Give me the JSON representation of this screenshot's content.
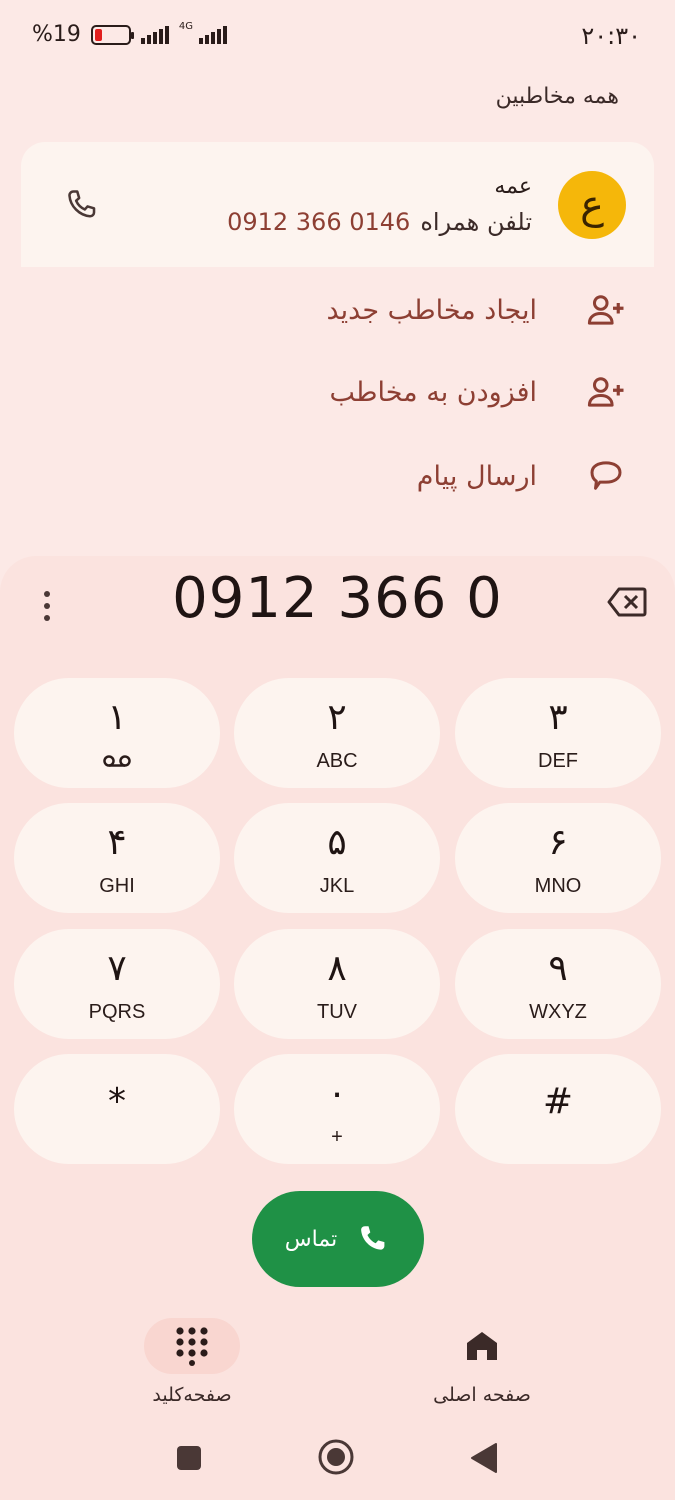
{
  "status_bar": {
    "time": "۲۰:۳۰",
    "battery": "%19",
    "battery_level": 0.19,
    "network": "4G"
  },
  "header": {
    "all_contacts": "همه مخاطبین"
  },
  "contact": {
    "avatar_letter": "ع",
    "name": "عمه",
    "phone_label": "تلفن همراه",
    "phone": "0912 366 0146"
  },
  "actions": [
    {
      "label": "ایجاد مخاطب جدید",
      "icon": "person-add-icon"
    },
    {
      "label": "افزودن به مخاطب",
      "icon": "person-add-icon"
    },
    {
      "label": "ارسال پیام",
      "icon": "message-icon"
    }
  ],
  "dialer": {
    "number": "0912 366 0",
    "keys": [
      {
        "digit": "۱",
        "letters": ""
      },
      {
        "digit": "۲",
        "letters": "ABC"
      },
      {
        "digit": "۳",
        "letters": "DEF"
      },
      {
        "digit": "۴",
        "letters": "GHI"
      },
      {
        "digit": "۵",
        "letters": "JKL"
      },
      {
        "digit": "۶",
        "letters": "MNO"
      },
      {
        "digit": "۷",
        "letters": "PQRS"
      },
      {
        "digit": "۸",
        "letters": "TUV"
      },
      {
        "digit": "۹",
        "letters": "WXYZ"
      },
      {
        "digit": "*",
        "letters": ""
      },
      {
        "digit": "۰",
        "letters": "+"
      },
      {
        "digit": "#",
        "letters": ""
      }
    ],
    "call_label": "تماس"
  },
  "bottom_nav": {
    "keypad_label": "صفحه‌کلید",
    "home_label": "صفحه اصلی"
  },
  "colors": {
    "background": "#fce9e6",
    "accent": "#8d3f33",
    "call_green": "#1f9146",
    "avatar": "#f5b70a"
  }
}
